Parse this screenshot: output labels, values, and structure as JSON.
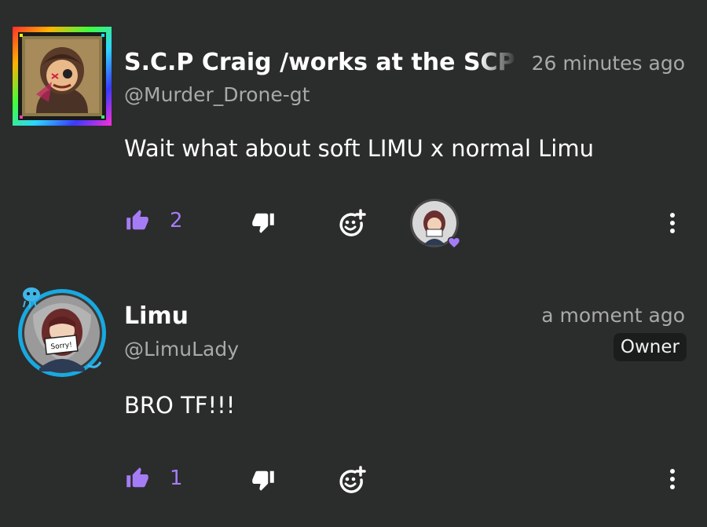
{
  "comments": [
    {
      "author": "S.C.P Craig /works at the SCP foundation/",
      "handle": "@Murder_Drone-gt",
      "time": "26 minutes ago",
      "text": "Wait what about soft LIMU x normal Limu",
      "likes": "2",
      "actions": {
        "like_icon": "thumbs-up-icon",
        "dislike_icon": "thumbs-down-icon",
        "react_icon": "add-reaction-icon",
        "more_icon": "more-vertical-icon"
      },
      "reacted_by_creator": true
    },
    {
      "author": "Limu",
      "handle": "@LimuLady",
      "time": "a moment ago",
      "badge": "Owner",
      "avatar_sign": "Sorry!",
      "text": "BRO TF!!!",
      "likes": "1",
      "actions": {
        "like_icon": "thumbs-up-icon",
        "dislike_icon": "thumbs-down-icon",
        "react_icon": "add-reaction-icon",
        "more_icon": "more-vertical-icon"
      }
    }
  ],
  "colors": {
    "background": "#2b2c2c",
    "accent": "#a57cf5",
    "muted_text": "#a9a9a9"
  }
}
